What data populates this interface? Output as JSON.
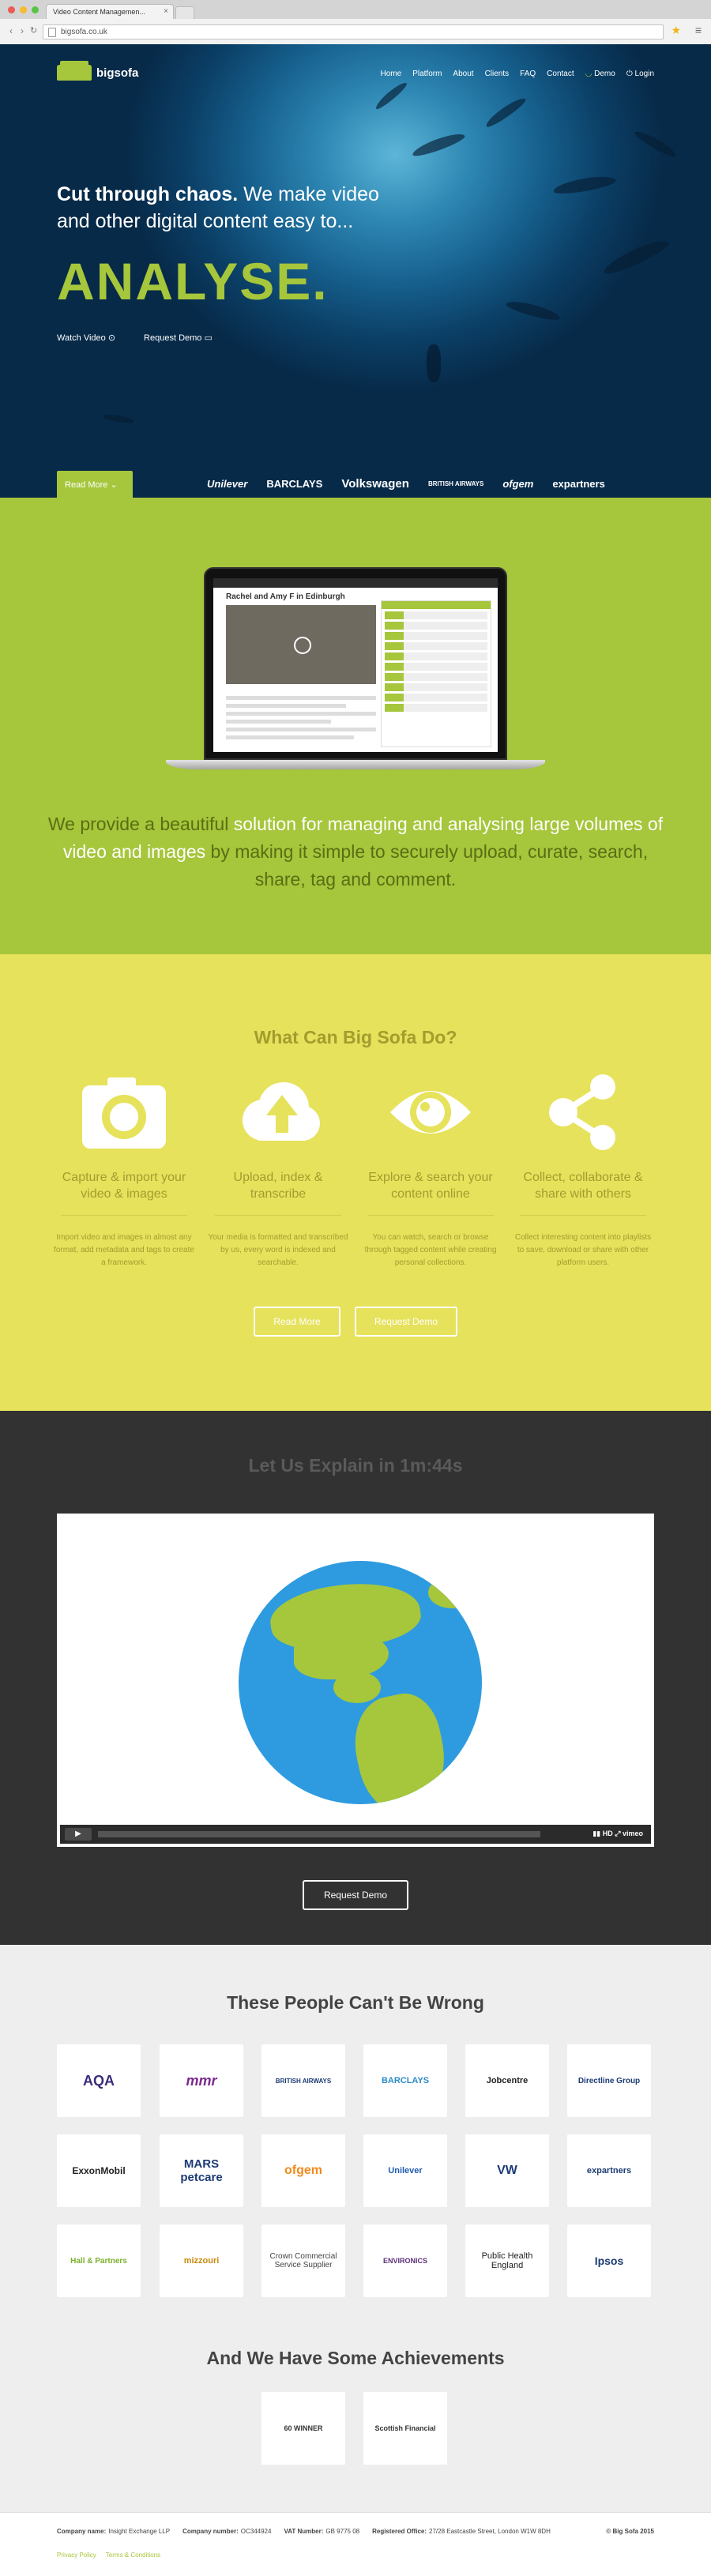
{
  "browser": {
    "tab_title": "Video Content Managemen...",
    "url": "bigsofa.co.uk"
  },
  "header": {
    "logo_text": "bigsofa",
    "nav": [
      "Home",
      "Platform",
      "About",
      "Clients",
      "FAQ",
      "Contact"
    ],
    "demo_label": "Demo",
    "login_label": "Login"
  },
  "hero": {
    "line1_bold": "Cut through chaos.",
    "line1_rest": "We make video",
    "line2": "and other digital content easy to...",
    "big_word": "ANALYSE.",
    "watch_video": "Watch Video",
    "request_demo": "Request Demo",
    "read_more": "Read More",
    "clients": [
      "Unilever",
      "BARCLAYS",
      "Volkswagen",
      "BRITISH AIRWAYS",
      "ofgem",
      "expartners"
    ]
  },
  "intro": {
    "screen_title": "Rachel and Amy F in Edinburgh",
    "text_a": "We provide a beautiful ",
    "text_b": "solution for managing and analysing large volumes of video and images",
    "text_c": " by making it simple to securely upload, curate, search, share, tag and comment."
  },
  "features": {
    "title": "What Can Big Sofa Do?",
    "items": [
      {
        "icon": "camera-icon",
        "title": "Capture & import your video & images",
        "desc": "Import video and images in almost any format, add metadata and tags to create a framework."
      },
      {
        "icon": "cloud-upload-icon",
        "title": "Upload, index & transcribe",
        "desc": "Your media is formatted and transcribed by us, every word is indexed and searchable."
      },
      {
        "icon": "eye-icon",
        "title": "Explore & search your content online",
        "desc": "You can watch, search or browse through tagged content while creating personal collections."
      },
      {
        "icon": "share-icon",
        "title": "Collect, collaborate & share with others",
        "desc": "Collect interesting content into playlists to save, download or share with other platform users."
      }
    ],
    "read_more": "Read More",
    "request_demo": "Request Demo"
  },
  "explain": {
    "title": "Let Us Explain in 1m:44s",
    "hd_label": "HD",
    "vimeo_label": "vimeo",
    "request_demo": "Request Demo"
  },
  "clients": {
    "title": "These People Can't Be Wrong",
    "logos": [
      "AQA",
      "mmr",
      "BRITISH AIRWAYS",
      "BARCLAYS",
      "Jobcentre",
      "Directline Group",
      "ExxonMobil",
      "MARS petcare",
      "ofgem",
      "Unilever",
      "VW",
      "expartners",
      "Hall & Partners",
      "mizzouri",
      "Crown Commercial Service Supplier",
      "ENVIRONICS",
      "Public Health England",
      "Ipsos"
    ],
    "achievements_title": "And We Have Some Achievements",
    "achievements": [
      "60 WINNER",
      "Scottish Financial"
    ]
  },
  "footer": {
    "company_name_label": "Company name:",
    "company_name": "Insight Exchange LLP",
    "company_number_label": "Company number:",
    "company_number": "OC344924",
    "vat_label": "VAT Number:",
    "vat": "GB 9775 08",
    "office_label": "Registered Office:",
    "office": "27/28 Eastcastle Street, London W1W 8DH",
    "copyright": "© Big Sofa 2015",
    "privacy": "Privacy Policy",
    "terms": "Terms & Conditions"
  },
  "colors": {
    "accent": "#a6c63b",
    "yellow": "#e6e25c",
    "dark": "#323232"
  }
}
